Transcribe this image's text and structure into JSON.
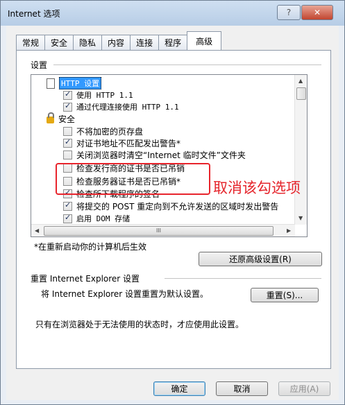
{
  "window": {
    "title": "Internet 选项",
    "help_glyph": "?",
    "close_glyph": "✕"
  },
  "tabs": [
    {
      "label": "常规"
    },
    {
      "label": "安全"
    },
    {
      "label": "隐私"
    },
    {
      "label": "内容"
    },
    {
      "label": "连接"
    },
    {
      "label": "程序"
    },
    {
      "label": "高级",
      "active": true
    }
  ],
  "settings": {
    "group_label": "设置",
    "items": [
      {
        "text": "HTTP 设置",
        "kind": "doc"
      },
      {
        "text": "使用 HTTP 1.1",
        "checked": true
      },
      {
        "text": "通过代理连接使用 HTTP 1.1",
        "checked": true
      },
      {
        "text": "安全",
        "kind": "lock"
      },
      {
        "text": "不将加密的页存盘",
        "checked": false
      },
      {
        "text": "对证书地址不匹配发出警告*",
        "checked": true
      },
      {
        "text": "关闭浏览器时清空“Internet 临时文件”文件夹",
        "checked": false
      },
      {
        "text": "检查发行商的证书是否已吊销",
        "checked": false
      },
      {
        "text": "检查服务器证书是否已吊销*",
        "checked": false
      },
      {
        "text": "检查所下载程序的签名",
        "checked": true
      },
      {
        "text": "将提交的 POST 重定向到不允许发送的区域时发出警告",
        "checked": true
      },
      {
        "text": "启用 DOM 存储",
        "checked": true
      }
    ],
    "scroll_h_glyph": "III",
    "restart_note": "*在重新启动你的计算机后生效",
    "restore_button": "还原高级设置(R)"
  },
  "reset": {
    "group_label": "重置 Internet Explorer 设置",
    "description": "将 Internet Explorer 设置重置为默认设置。",
    "reset_button": "重置(S)...",
    "note": "只有在浏览器处于无法使用的状态时，才应使用此设置。"
  },
  "annotation": {
    "text": "取消该勾选项",
    "color": "#e5242b"
  },
  "footer": {
    "ok": "确定",
    "cancel": "取消",
    "apply": "应用(A)"
  }
}
